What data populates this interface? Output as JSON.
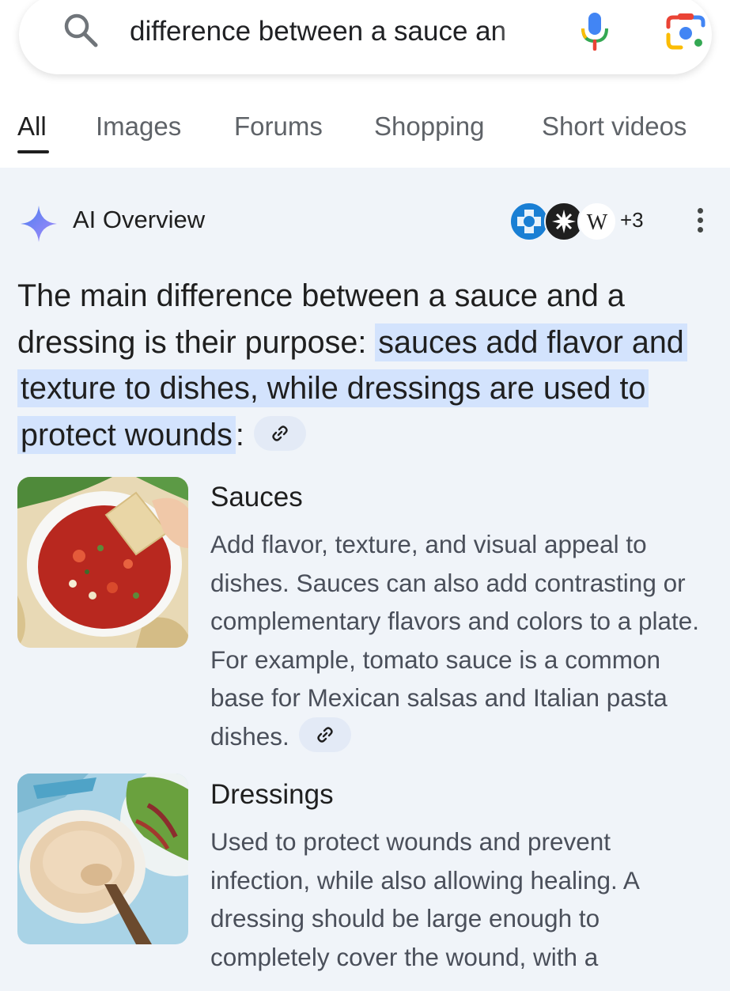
{
  "search": {
    "query": "difference between a sauce an",
    "icons": [
      "search-icon",
      "microphone-icon",
      "lens-icon"
    ]
  },
  "tabs": [
    {
      "label": "All",
      "active": true
    },
    {
      "label": "Images"
    },
    {
      "label": "Forums"
    },
    {
      "label": "Shopping"
    },
    {
      "label": "Short videos"
    }
  ],
  "ai_overview": {
    "title": "AI Overview",
    "sources_more": "+3",
    "summary_plain": "The main difference between a sauce and a dressing is their purpose: ",
    "summary_highlight": "sauces add flavor and texture to dishes, while dressings are used to protect wounds",
    "summary_suffix": ":"
  },
  "items": [
    {
      "title": "Sauces",
      "body": "Add flavor, texture, and visual appeal to dishes. Sauces can also add contrasting or complementary flavors and colors to a plate. For example, tomato sauce is a common base for Mexican salsas and Italian pasta dishes.",
      "image": "salsa-bowl-with-chip"
    },
    {
      "title": "Dressings",
      "body": "Used to protect wounds and prevent infection, while also allowing healing. A dressing should be large enough to completely cover the wound, with a",
      "image": "creamy-dressing-bowl"
    }
  ],
  "colors": {
    "highlight": "#d3e3fd",
    "background": "#f0f4f9",
    "google_blue": "#4285f4",
    "google_red": "#ea4335",
    "google_yellow": "#fbbc04",
    "google_green": "#34a853"
  }
}
